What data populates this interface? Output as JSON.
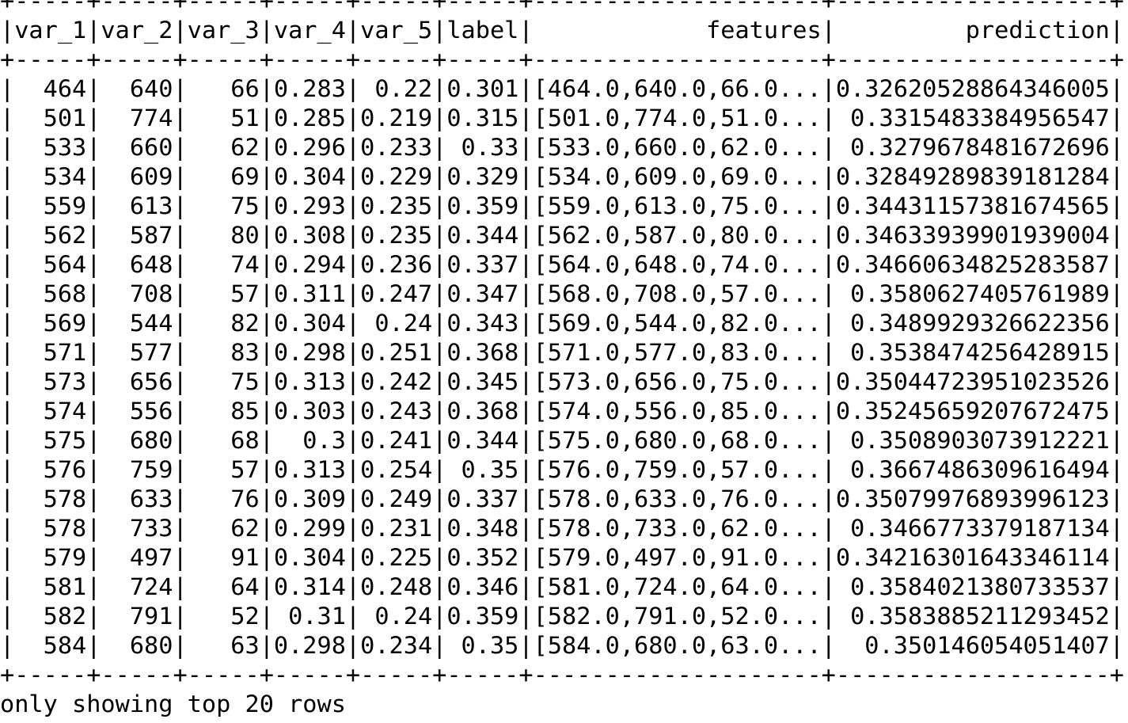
{
  "columns": [
    "var_1",
    "var_2",
    "var_3",
    "var_4",
    "var_5",
    "label",
    "features",
    "prediction"
  ],
  "rows": [
    [
      "464",
      "640",
      "66",
      "0.283",
      "0.22",
      "0.301",
      "[464.0,640.0,66.0...",
      "0.32620528864346005"
    ],
    [
      "501",
      "774",
      "51",
      "0.285",
      "0.219",
      "0.315",
      "[501.0,774.0,51.0...",
      "0.3315483384956547"
    ],
    [
      "533",
      "660",
      "62",
      "0.296",
      "0.233",
      "0.33",
      "[533.0,660.0,62.0...",
      "0.3279678481672696"
    ],
    [
      "534",
      "609",
      "69",
      "0.304",
      "0.229",
      "0.329",
      "[534.0,609.0,69.0...",
      "0.32849289839181284"
    ],
    [
      "559",
      "613",
      "75",
      "0.293",
      "0.235",
      "0.359",
      "[559.0,613.0,75.0...",
      "0.34431157381674565"
    ],
    [
      "562",
      "587",
      "80",
      "0.308",
      "0.235",
      "0.344",
      "[562.0,587.0,80.0...",
      "0.34633939901939004"
    ],
    [
      "564",
      "648",
      "74",
      "0.294",
      "0.236",
      "0.337",
      "[564.0,648.0,74.0...",
      "0.34660634825283587"
    ],
    [
      "568",
      "708",
      "57",
      "0.311",
      "0.247",
      "0.347",
      "[568.0,708.0,57.0...",
      "0.3580627405761989"
    ],
    [
      "569",
      "544",
      "82",
      "0.304",
      "0.24",
      "0.343",
      "[569.0,544.0,82.0...",
      "0.3489929326622356"
    ],
    [
      "571",
      "577",
      "83",
      "0.298",
      "0.251",
      "0.368",
      "[571.0,577.0,83.0...",
      "0.3538474256428915"
    ],
    [
      "573",
      "656",
      "75",
      "0.313",
      "0.242",
      "0.345",
      "[573.0,656.0,75.0...",
      "0.35044723951023526"
    ],
    [
      "574",
      "556",
      "85",
      "0.303",
      "0.243",
      "0.368",
      "[574.0,556.0,85.0...",
      "0.35245659207672475"
    ],
    [
      "575",
      "680",
      "68",
      "0.3",
      "0.241",
      "0.344",
      "[575.0,680.0,68.0...",
      "0.3508903073912221"
    ],
    [
      "576",
      "759",
      "57",
      "0.313",
      "0.254",
      "0.35",
      "[576.0,759.0,57.0...",
      "0.3667486309616494"
    ],
    [
      "578",
      "633",
      "76",
      "0.309",
      "0.249",
      "0.337",
      "[578.0,633.0,76.0...",
      "0.35079976893996123"
    ],
    [
      "578",
      "733",
      "62",
      "0.299",
      "0.231",
      "0.348",
      "[578.0,733.0,62.0...",
      "0.3466773379187134"
    ],
    [
      "579",
      "497",
      "91",
      "0.304",
      "0.225",
      "0.352",
      "[579.0,497.0,91.0...",
      "0.34216301643346114"
    ],
    [
      "581",
      "724",
      "64",
      "0.314",
      "0.248",
      "0.346",
      "[581.0,724.0,64.0...",
      "0.3584021380733537"
    ],
    [
      "582",
      "791",
      "52",
      "0.31",
      "0.24",
      "0.359",
      "[582.0,791.0,52.0...",
      "0.3583885211293452"
    ],
    [
      "584",
      "680",
      "63",
      "0.298",
      "0.234",
      "0.35",
      "[584.0,680.0,63.0...",
      "0.350146054051407"
    ]
  ],
  "footer": "only showing top 20 rows"
}
